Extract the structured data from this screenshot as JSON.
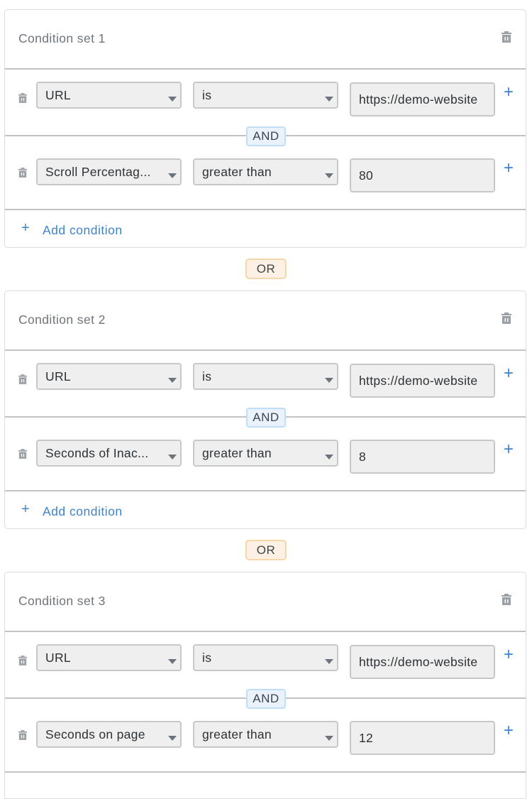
{
  "colors": {
    "accent": "#3d84d0",
    "and_bg": "#eaf3fc",
    "and_border": "#bfdef7",
    "or_bg": "#fdf1e5",
    "or_border": "#f6d7a7",
    "input_bg": "#efefef",
    "icon_gray": "#9aa0a6"
  },
  "labels": {
    "and": "AND",
    "or": "OR",
    "add_condition": "Add condition",
    "add_condition_icon": "+",
    "add_row_icon": "+"
  },
  "condition_sets": [
    {
      "title": "Condition set 1",
      "conditions": [
        {
          "field": "URL",
          "operator": "is",
          "value": "https://demo-website"
        },
        {
          "field": "Scroll Percentag...",
          "operator": "greater than",
          "value": "80"
        }
      ]
    },
    {
      "title": "Condition set 2",
      "conditions": [
        {
          "field": "URL",
          "operator": "is",
          "value": "https://demo-website"
        },
        {
          "field": "Seconds of Inac...",
          "operator": "greater than",
          "value": "8"
        }
      ]
    },
    {
      "title": "Condition set 3",
      "conditions": [
        {
          "field": "URL",
          "operator": "is",
          "value": "https://demo-website"
        },
        {
          "field": "Seconds on page",
          "operator": "greater than",
          "value": "12"
        }
      ]
    }
  ]
}
